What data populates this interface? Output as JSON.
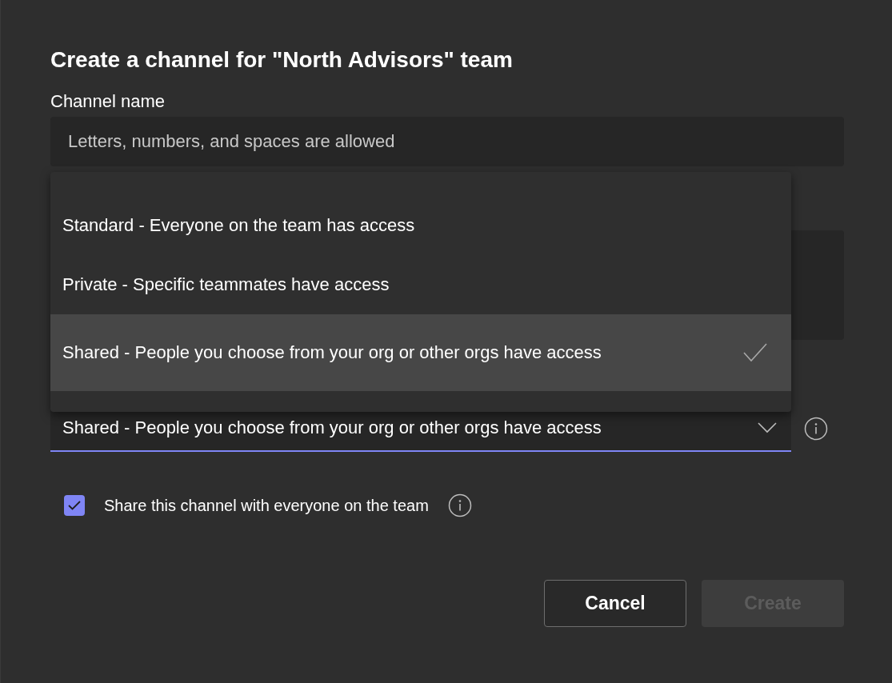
{
  "dialog": {
    "title": "Create a channel for \"North Advisors\" team",
    "channel_name": {
      "label": "Channel name",
      "placeholder": "Letters, numbers, and spaces are allowed"
    },
    "privacy": {
      "value": "Shared - People you choose from your org or other orgs have access",
      "menu_open": true,
      "options": [
        {
          "label": "Standard - Everyone on the team has access",
          "selected": false
        },
        {
          "label": "Private - Specific teammates have access",
          "selected": false
        },
        {
          "label": "Shared - People you choose from your org or other orgs have access",
          "selected": true
        }
      ]
    },
    "share_with_team": {
      "label": "Share this channel with everyone on the team",
      "checked": true
    },
    "buttons": [
      {
        "label": "Cancel",
        "disabled": false
      },
      {
        "label": "Create",
        "disabled": true
      }
    ]
  }
}
